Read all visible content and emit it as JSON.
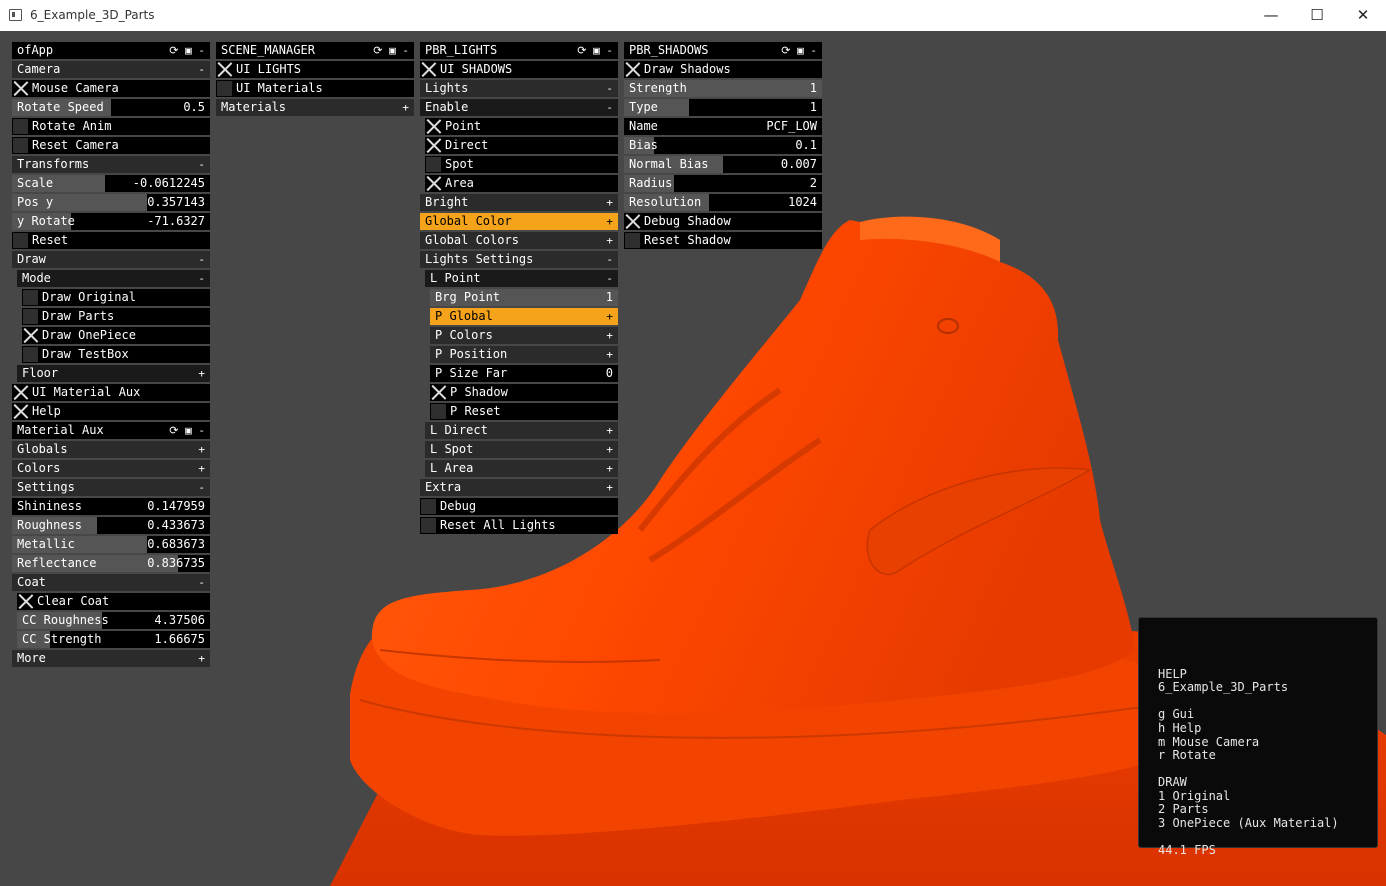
{
  "window": {
    "title": "6_Example_3D_Parts",
    "min": "—",
    "max": "☐",
    "close": "✕"
  },
  "icons": {
    "reload": "⟳",
    "save": "▣",
    "minus": "-",
    "plus": "+"
  },
  "ofapp": {
    "title": "ofApp",
    "camera": "Camera",
    "mouse_camera": "Mouse Camera",
    "rotate_speed": {
      "label": "Rotate Speed",
      "value": "0.5",
      "fraction": 0.5
    },
    "rotate_anim": "Rotate Anim",
    "reset_camera": "Reset Camera",
    "transforms": "Transforms",
    "scale": {
      "label": "Scale",
      "value": "-0.0612245",
      "fraction": 0.47
    },
    "pos_y": {
      "label": "Pos y",
      "value": "0.357143",
      "fraction": 0.68
    },
    "y_rotate": {
      "label": "y Rotate",
      "value": "-71.6327",
      "fraction": 0.3
    },
    "reset": "Reset",
    "draw": "Draw",
    "mode": "Mode",
    "draw_original": "Draw Original",
    "draw_parts": "Draw Parts",
    "draw_onepiece": "Draw OnePiece",
    "draw_testbox": "Draw TestBox",
    "floor": "Floor",
    "ui_material_aux": "UI Material Aux",
    "help": "Help",
    "material_aux": "Material Aux",
    "globals": "Globals",
    "colors": "Colors",
    "settings": "Settings",
    "shininess": {
      "label": "Shininess",
      "value": "0.147959",
      "fraction": 0.0
    },
    "roughness": {
      "label": "Roughness",
      "value": "0.433673",
      "fraction": 0.43
    },
    "metallic": {
      "label": "Metallic",
      "value": "0.683673",
      "fraction": 0.68
    },
    "reflectance": {
      "label": "Reflectance",
      "value": "0.836735",
      "fraction": 0.84
    },
    "coat": "Coat",
    "clear_coat": "Clear Coat",
    "cc_roughness": {
      "label": "CC Roughness",
      "value": "4.37506",
      "fraction": 0.44
    },
    "cc_strength": {
      "label": "CC Strength",
      "value": "1.66675",
      "fraction": 0.17
    },
    "more": "More"
  },
  "scene_manager": {
    "title": "SCENE_MANAGER",
    "ui_lights": "UI LIGHTS",
    "ui_materials": "UI Materials",
    "materials": "Materials"
  },
  "pbr_lights": {
    "title": "PBR_LIGHTS",
    "ui_shadows": "UI SHADOWS",
    "lights": "Lights",
    "enable": "Enable",
    "point": "Point",
    "direct": "Direct",
    "spot": "Spot",
    "area": "Area",
    "bright": "Bright",
    "global_color": "Global Color",
    "global_colors": "Global Colors",
    "lights_settings": "Lights Settings",
    "l_point": "L Point",
    "brg_point": {
      "label": "Brg Point",
      "value": "1",
      "fraction": 1.0
    },
    "p_global": "P Global",
    "p_colors": "P Colors",
    "p_position": "P Position",
    "p_size_far": {
      "label": "P Size Far",
      "value": "0",
      "fraction": 0.0
    },
    "p_shadow": "P Shadow",
    "p_reset": "P Reset",
    "l_direct": "L Direct",
    "l_spot": "L Spot",
    "l_area": "L Area",
    "extra": "Extra",
    "debug": "Debug",
    "reset_all_lights": "Reset All Lights"
  },
  "pbr_shadows": {
    "title": "PBR_SHADOWS",
    "draw_shadows": "Draw Shadows",
    "strength": {
      "label": "Strength",
      "value": "1",
      "fraction": 1.0
    },
    "type": {
      "label": "Type",
      "value": "1",
      "fraction": 0.33
    },
    "name": {
      "label": "Name",
      "value": "PCF_LOW"
    },
    "bias": {
      "label": "Bias",
      "value": "0.1",
      "fraction": 0.15
    },
    "normal_bias": {
      "label": "Normal Bias",
      "value": "0.007",
      "fraction": 0.5
    },
    "radius": {
      "label": "Radius",
      "value": "2",
      "fraction": 0.25
    },
    "resolution": {
      "label": "Resolution",
      "value": "1024",
      "fraction": 0.43
    },
    "debug_shadow": "Debug Shadow",
    "reset_shadow": "Reset Shadow"
  },
  "help_overlay": {
    "l1": "HELP",
    "l2": "6_Example_3D_Parts",
    "l3": "g Gui",
    "l4": "h Help",
    "l5": "m Mouse Camera",
    "l6": "r Rotate",
    "l7": "DRAW",
    "l8": "1 Original",
    "l9": "2 Parts",
    "l10": "3 OnePiece (Aux Material)",
    "l11": "44.1 FPS"
  },
  "colors": {
    "orange_highlight": "#f5a31a",
    "shoe": "#ff4a00",
    "background": "#474747"
  }
}
